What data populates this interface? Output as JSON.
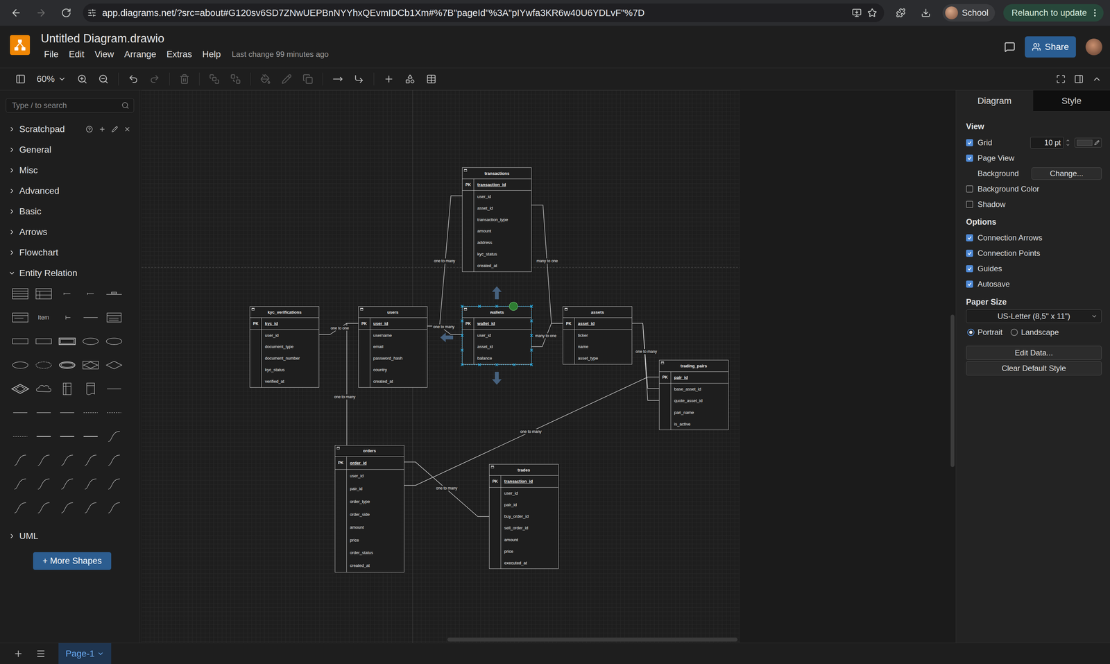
{
  "browser": {
    "url": "app.diagrams.net/?src=about#G120sv6SD7ZNwUEPBnNYYhxQEvmIDCb1Xm#%7B\"pageId\"%3A\"pIYwfa3KR6w40U6YDLvF\"%7D",
    "profile": "School",
    "relaunch": "Relaunch to update"
  },
  "app": {
    "title": "Untitled Diagram.drawio",
    "menus": [
      "File",
      "Edit",
      "View",
      "Arrange",
      "Extras",
      "Help"
    ],
    "last_change": "Last change 99 minutes ago",
    "share": "Share"
  },
  "toolbar": {
    "zoom": "60%",
    "buttons": [
      {
        "disabled": false
      },
      {
        "disabled": false
      },
      {
        "disabled": false
      },
      {
        "disabled": false
      },
      {
        "disabled": true
      },
      {
        "disabled": true
      },
      {
        "disabled": true
      },
      {
        "disabled": true
      },
      {
        "disabled": true
      },
      {
        "disabled": true
      },
      {
        "disabled": true
      },
      {
        "disabled": false
      },
      {
        "disabled": false
      },
      {
        "disabled": false
      },
      {
        "disabled": false
      },
      {
        "disabled": false
      }
    ]
  },
  "sidebar": {
    "search_placeholder": "Type / to search",
    "sections": [
      {
        "label": "Scratchpad",
        "expanded": false,
        "kind": "scratchpad"
      },
      {
        "label": "General",
        "expanded": false,
        "kind": "section"
      },
      {
        "label": "Misc",
        "expanded": false,
        "kind": "section"
      },
      {
        "label": "Advanced",
        "expanded": false,
        "kind": "section"
      },
      {
        "label": "Basic",
        "expanded": false,
        "kind": "section"
      },
      {
        "label": "Arrows",
        "expanded": false,
        "kind": "section"
      },
      {
        "label": "Flowchart",
        "expanded": false,
        "kind": "section"
      },
      {
        "label": "Entity Relation",
        "expanded": true,
        "kind": "section"
      }
    ],
    "shapes": [
      {
        "kind": "table"
      },
      {
        "kind": "table2"
      },
      {
        "kind": "tiny-line"
      },
      {
        "kind": "tiny-line"
      },
      {
        "kind": "label-line"
      },
      {
        "kind": "list"
      },
      {
        "kind": "item",
        "label": "Item"
      },
      {
        "kind": "bracket-line"
      },
      {
        "kind": "line"
      },
      {
        "kind": "table-small"
      },
      {
        "kind": "entity"
      },
      {
        "kind": "entity"
      },
      {
        "kind": "entity-bold"
      },
      {
        "kind": "attribute"
      },
      {
        "kind": "attribute"
      },
      {
        "kind": "attribute"
      },
      {
        "kind": "attribute-dashed"
      },
      {
        "kind": "attribute-double"
      },
      {
        "kind": "weak-relation"
      },
      {
        "kind": "relation"
      },
      {
        "kind": "relation-double"
      },
      {
        "kind": "cloud"
      },
      {
        "kind": "doc-split"
      },
      {
        "kind": "doc"
      },
      {
        "kind": "line"
      },
      {
        "kind": "line"
      },
      {
        "kind": "line"
      },
      {
        "kind": "line"
      },
      {
        "kind": "line-dashed"
      },
      {
        "kind": "line-dashed"
      },
      {
        "kind": "line-dashed"
      },
      {
        "kind": "line-bold"
      },
      {
        "kind": "line-bold"
      },
      {
        "kind": "line-bold"
      },
      {
        "kind": "curve"
      },
      {
        "kind": "curve"
      },
      {
        "kind": "curve"
      },
      {
        "kind": "curve"
      },
      {
        "kind": "curve"
      },
      {
        "kind": "curve"
      },
      {
        "kind": "curve"
      },
      {
        "kind": "curve"
      },
      {
        "kind": "curve"
      },
      {
        "kind": "curve"
      },
      {
        "kind": "curve"
      },
      {
        "kind": "curve"
      },
      {
        "kind": "curve"
      },
      {
        "kind": "curve"
      },
      {
        "kind": "curve"
      },
      {
        "kind": "curve"
      }
    ],
    "after_sections": [
      {
        "label": "UML",
        "expanded": false,
        "kind": "section"
      }
    ],
    "more_shapes": "+ More Shapes"
  },
  "canvas": {
    "entities": [
      {
        "name": "transactions",
        "selected": false,
        "rows": [
          {
            "key": "PK",
            "field": "transaction_id",
            "primary": true
          },
          {
            "key": "",
            "field": "user_id",
            "primary": false
          },
          {
            "key": "",
            "field": "asset_id",
            "primary": false
          },
          {
            "key": "",
            "field": "transaction_type",
            "primary": false
          },
          {
            "key": "",
            "field": "amount",
            "primary": false
          },
          {
            "key": "",
            "field": "address",
            "primary": false
          },
          {
            "key": "",
            "field": "kyc_status",
            "primary": false
          },
          {
            "key": "",
            "field": "created_at",
            "primary": false
          }
        ]
      },
      {
        "name": "kyc_verifications",
        "selected": false,
        "rows": [
          {
            "key": "PK",
            "field": "kyc_id",
            "primary": true
          },
          {
            "key": "",
            "field": "user_id",
            "primary": false
          },
          {
            "key": "",
            "field": "document_type",
            "primary": false
          },
          {
            "key": "",
            "field": "document_number",
            "primary": false
          },
          {
            "key": "",
            "field": "kyc_status",
            "primary": false
          },
          {
            "key": "",
            "field": "verified_at",
            "primary": false
          }
        ]
      },
      {
        "name": "users",
        "selected": false,
        "rows": [
          {
            "key": "PK",
            "field": "user_id",
            "primary": true
          },
          {
            "key": "",
            "field": "username",
            "primary": false
          },
          {
            "key": "",
            "field": "email",
            "primary": false
          },
          {
            "key": "",
            "field": "password_hash",
            "primary": false
          },
          {
            "key": "",
            "field": "country",
            "primary": false
          },
          {
            "key": "",
            "field": "created_at",
            "primary": false
          }
        ]
      },
      {
        "name": "wallets",
        "selected": true,
        "rows": [
          {
            "key": "PK",
            "field": "wallet_id",
            "primary": true
          },
          {
            "key": "",
            "field": "user_id",
            "primary": false
          },
          {
            "key": "",
            "field": "asset_id",
            "primary": false
          },
          {
            "key": "",
            "field": "balance",
            "primary": false
          }
        ]
      },
      {
        "name": "assets",
        "selected": false,
        "rows": [
          {
            "key": "PK",
            "field": "asset_id",
            "primary": true
          },
          {
            "key": "",
            "field": "ticker",
            "primary": false
          },
          {
            "key": "",
            "field": "name",
            "primary": false
          },
          {
            "key": "",
            "field": "asset_type",
            "primary": false
          }
        ]
      },
      {
        "name": "trading_pairs",
        "selected": false,
        "rows": [
          {
            "key": "PK",
            "field": "pair_id",
            "primary": true
          },
          {
            "key": "",
            "field": "base_asset_id",
            "primary": false
          },
          {
            "key": "",
            "field": "quote_asset_id",
            "primary": false
          },
          {
            "key": "",
            "field": "pari_name",
            "primary": false
          },
          {
            "key": "",
            "field": "is_active",
            "primary": false
          }
        ]
      },
      {
        "name": "orders",
        "selected": false,
        "rows": [
          {
            "key": "PK",
            "field": "order_id",
            "primary": true
          },
          {
            "key": "",
            "field": "user_id",
            "primary": false
          },
          {
            "key": "",
            "field": "pair_id",
            "primary": false
          },
          {
            "key": "",
            "field": "order_type",
            "primary": false
          },
          {
            "key": "",
            "field": "order_side",
            "primary": false
          },
          {
            "key": "",
            "field": "amount",
            "primary": false
          },
          {
            "key": "",
            "field": "price",
            "primary": false
          },
          {
            "key": "",
            "field": "order_status",
            "primary": false
          },
          {
            "key": "",
            "field": "created_at",
            "primary": false
          }
        ]
      },
      {
        "name": "trades",
        "selected": false,
        "rows": [
          {
            "key": "PK",
            "field": "transaction_id",
            "primary": true
          },
          {
            "key": "",
            "field": "user_id",
            "primary": false
          },
          {
            "key": "",
            "field": "pair_id",
            "primary": false
          },
          {
            "key": "",
            "field": "buy_order_id",
            "primary": false
          },
          {
            "key": "",
            "field": "sell_order_id",
            "primary": false
          },
          {
            "key": "",
            "field": "amount",
            "primary": false
          },
          {
            "key": "",
            "field": "price",
            "primary": false
          },
          {
            "key": "",
            "field": "executed_at",
            "primary": false
          }
        ]
      }
    ],
    "edges": [
      {
        "label": "one to many"
      },
      {
        "label": "many to one"
      },
      {
        "label": "one to one"
      },
      {
        "label": "one to many"
      },
      {
        "label": "many to one"
      },
      {
        "label": "one to many"
      },
      {
        "label": "one to many"
      },
      {
        "label": "one to many"
      },
      {
        "label": "one to many"
      }
    ]
  },
  "format": {
    "tabs": [
      {
        "label": "Diagram",
        "selected": true
      },
      {
        "label": "Style",
        "selected": false
      }
    ],
    "view": {
      "heading": "View",
      "items": [
        {
          "kind": "grid",
          "label": "Grid",
          "checked": true,
          "value": "10 pt"
        },
        {
          "kind": "check",
          "label": "Page View",
          "checked": true
        },
        {
          "kind": "background",
          "label": "Background",
          "button": "Change..."
        },
        {
          "kind": "check",
          "label": "Background Color",
          "checked": false
        },
        {
          "kind": "check",
          "label": "Shadow",
          "checked": false
        }
      ]
    },
    "options": {
      "heading": "Options",
      "items": [
        {
          "label": "Connection Arrows",
          "checked": true
        },
        {
          "label": "Connection Points",
          "checked": true
        },
        {
          "label": "Guides",
          "checked": true
        },
        {
          "label": "Autosave",
          "checked": true
        }
      ]
    },
    "paper": {
      "heading": "Paper Size",
      "value": "US-Letter (8,5\" x 11\")",
      "orientations": [
        {
          "label": "Portrait",
          "selected": true
        },
        {
          "label": "Landscape",
          "selected": false
        }
      ]
    },
    "buttons": [
      "Edit Data...",
      "Clear Default Style"
    ]
  },
  "pages": [
    {
      "label": "Page-1",
      "selected": true
    }
  ]
}
